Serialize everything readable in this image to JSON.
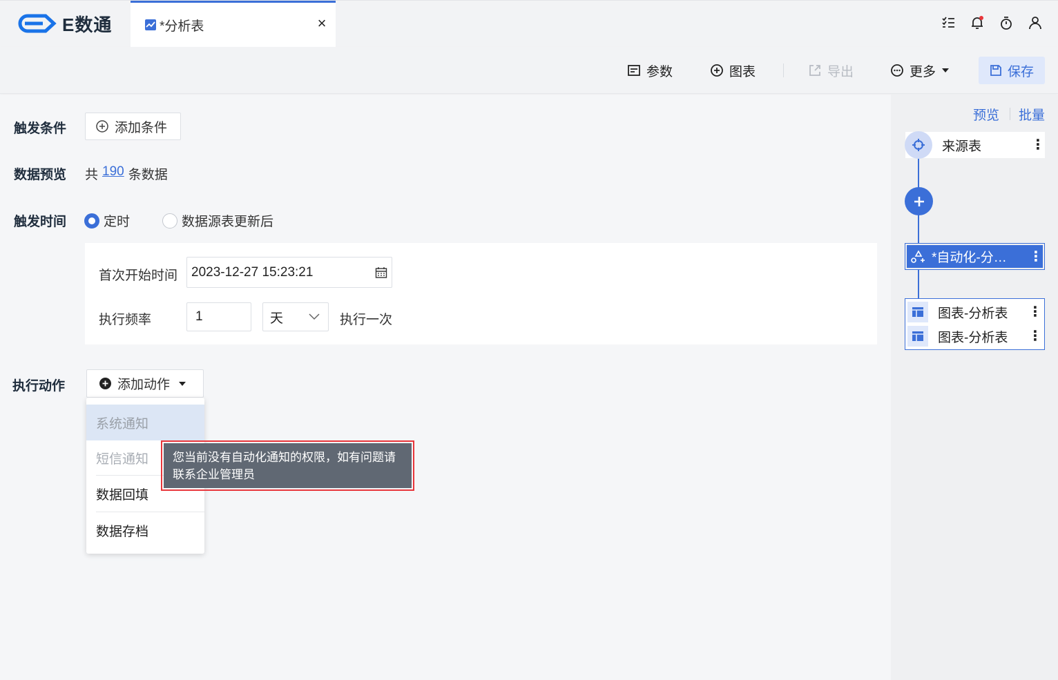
{
  "app": {
    "logo_text": "E数通"
  },
  "tab": {
    "label": "*分析表",
    "close": "×"
  },
  "toolbar": {
    "params": "参数",
    "chart": "图表",
    "export": "导出",
    "more": "更多",
    "save": "保存"
  },
  "form": {
    "trigger_condition_label": "触发条件",
    "add_condition": "添加条件",
    "data_preview_label": "数据预览",
    "preview_prefix": "共",
    "preview_count": "190",
    "preview_suffix": "条数据",
    "trigger_time_label": "触发时间",
    "radio_scheduled": "定时",
    "radio_after_update": "数据源表更新后",
    "first_start_label": "首次开始时间",
    "first_start_value": "2023-12-27 15:23:21",
    "frequency_label": "执行频率",
    "frequency_value": "1",
    "frequency_unit": "天",
    "frequency_suffix": "执行一次",
    "action_label": "执行动作",
    "add_action": "添加动作"
  },
  "action_menu": {
    "items": [
      "系统通知",
      "短信通知",
      "数据回填",
      "数据存档"
    ]
  },
  "tooltip": {
    "text": "您当前没有自动化通知的权限，如有问题请联系企业管理员"
  },
  "sidebar": {
    "preview": "预览",
    "batch": "批量",
    "source_node": "来源表",
    "automation_node": "*自动化-分…",
    "chart_nodes": [
      "图表-分析表",
      "图表-分析表"
    ]
  },
  "colors": {
    "accent": "#3b6fd8",
    "tooltip_bg": "#606873",
    "highlight_border": "#e8353a"
  }
}
